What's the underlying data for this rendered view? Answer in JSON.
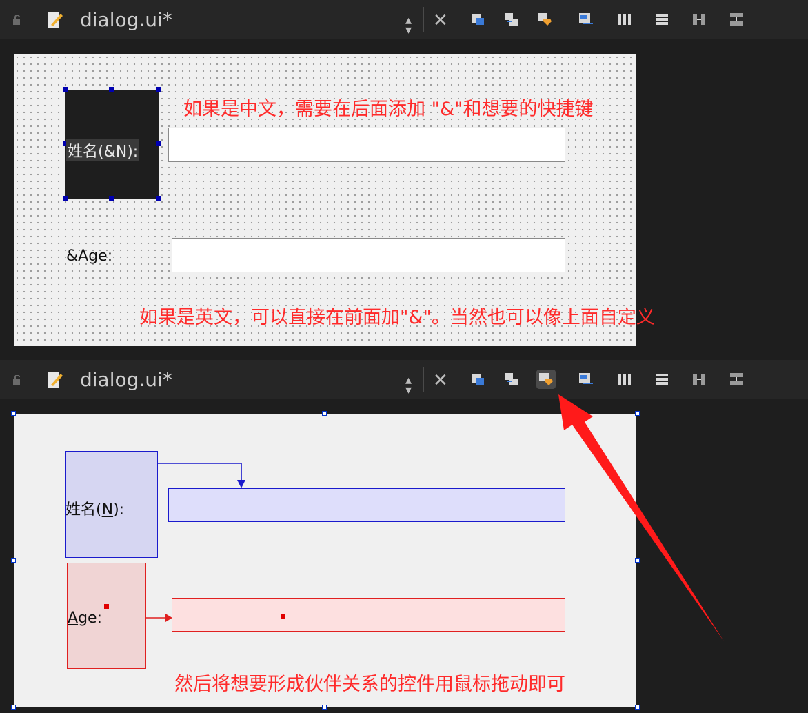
{
  "top_panel": {
    "file_name": "dialog.ui*",
    "label_name": "姓名(&N):",
    "label_age": "&Age:",
    "note_chinese": "如果是中文，需要在后面添加 \"&\"和想要的快捷键",
    "note_english": "如果是英文，可以直接在前面加\"&\"。当然也可以像上面自定义"
  },
  "bottom_panel": {
    "file_name": "dialog.ui*",
    "label_name_prefix": "姓名(",
    "label_name_key": "N",
    "label_name_suffix": "):",
    "label_age_key": "A",
    "label_age_rest": "ge:",
    "note_buddy": "然后将想要形成伙伴关系的控件用鼠标拖动即可"
  },
  "toolbar_icons": [
    "edit-widgets-icon",
    "edit-signals-slots-icon",
    "edit-buddies-icon",
    "edit-tab-order-icon",
    "layout-horizontal-icon",
    "layout-vertical-icon",
    "layout-horizontal-splitter-icon",
    "layout-vertical-splitter-icon"
  ],
  "colors": {
    "annotation_red": "#ff2a2a",
    "buddy_blue": "#1a1acc",
    "buddy_red": "#e02020"
  }
}
